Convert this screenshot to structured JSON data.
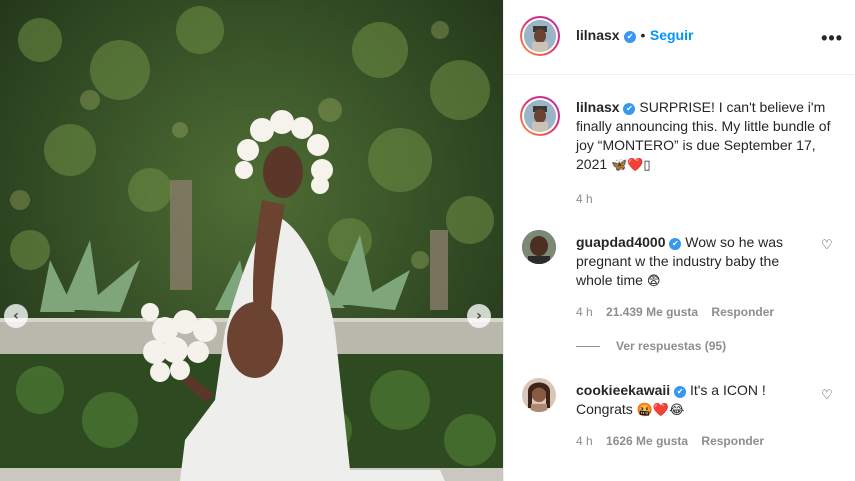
{
  "post": {
    "username": "lilnasx",
    "follow_label": "Seguir",
    "separator": "•",
    "more_label": "•••",
    "caption": "SURPRISE! I can't believe i'm finally announcing this. My little bundle of joy “MONTERO” is due September 17, 2021",
    "caption_emojis": "🦋❤️▯",
    "time": "4 h"
  },
  "comments": [
    {
      "username": "guapdad4000",
      "text": "Wow so he was pregnant w the industry baby the whole time",
      "emoji": "😨",
      "time": "4 h",
      "likes": "21.439 Me gusta",
      "reply_label": "Responder",
      "view_replies": "Ver respuestas (95)"
    },
    {
      "username": "cookieekawaii",
      "text": "It's a ICON ! Congrats",
      "emoji": "🤬❤️😂",
      "time": "4 h",
      "likes": "1626 Me gusta",
      "reply_label": "Responder"
    }
  ],
  "icons": {
    "verified": "✔",
    "heart": "♡",
    "prev": "‹",
    "next": "›"
  },
  "colors": {
    "link_blue": "#0095f6",
    "verified_blue": "#3897f0",
    "muted": "#8e8e8e"
  }
}
